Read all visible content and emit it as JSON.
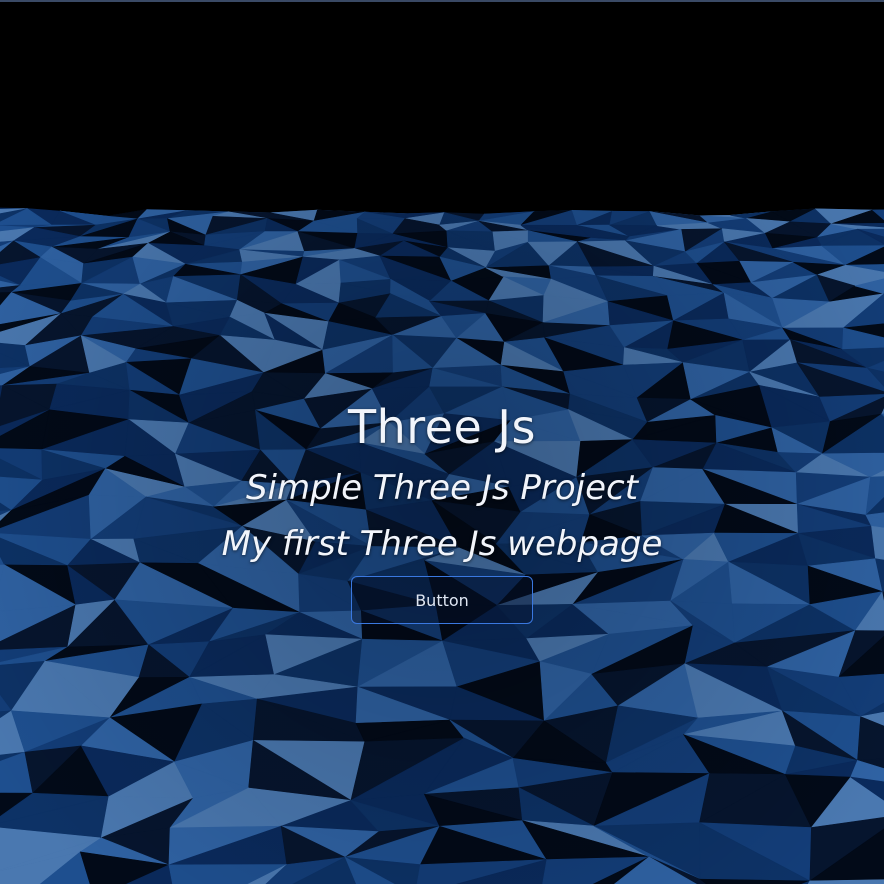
{
  "hero": {
    "title": "Three Js",
    "subtitle": "Simple Three Js Project",
    "tagline": "My first Three Js webpage",
    "button_label": "Button"
  },
  "scene": {
    "sky_color": "#000000",
    "terrain_palette": [
      "#06152e",
      "#0a2a5c",
      "#133d78",
      "#1e4f8f",
      "#2f62a3",
      "#4a78b0",
      "#020a18",
      "#0d3266"
    ],
    "terrain_style": "low-poly"
  }
}
